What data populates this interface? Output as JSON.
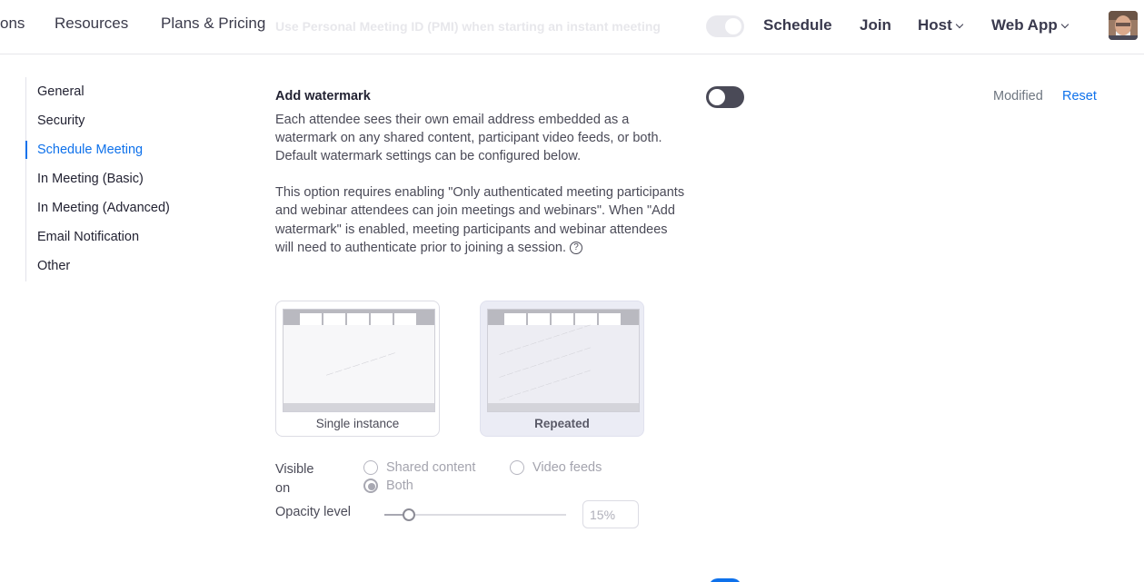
{
  "nav": {
    "left_items": [
      "ons",
      "Resources",
      "Plans & Pricing"
    ],
    "ghost_setting": "Use Personal Meeting ID (PMI) when starting an instant meeting",
    "right_items": {
      "schedule": "Schedule",
      "join": "Join",
      "host": "Host",
      "web_app": "Web App"
    }
  },
  "sidebar": {
    "items": [
      {
        "label": "General",
        "active": false
      },
      {
        "label": "Security",
        "active": false
      },
      {
        "label": "Schedule Meeting",
        "active": true
      },
      {
        "label": "In Meeting (Basic)",
        "active": false
      },
      {
        "label": "In Meeting (Advanced)",
        "active": false
      },
      {
        "label": "Email Notification",
        "active": false
      },
      {
        "label": "Other",
        "active": false
      }
    ]
  },
  "setting": {
    "title": "Add watermark",
    "enabled": false,
    "status": "Modified",
    "reset_label": "Reset",
    "desc1": "Each attendee sees their own email address embedded as a watermark on any shared content, participant video feeds, or both. Default watermark settings can be configured below.",
    "desc2": "This option requires enabling \"Only authenticated meeting participants and webinar attendees can join meetings and webinars\". When \"Add watermark\" is enabled, meeting participants and webinar attendees will need to authenticate prior to joining a session.",
    "help_icon": "question-circle-icon",
    "help_glyph": "?"
  },
  "modes": {
    "single": "Single instance",
    "repeated": "Repeated",
    "selected": "Repeated"
  },
  "visible_on": {
    "label_line1": "Visible",
    "label_line2": "on",
    "options": {
      "shared_content": "Shared content",
      "video_feeds": "Video feeds",
      "both": "Both"
    },
    "selected": "Both"
  },
  "opacity": {
    "label": "Opacity level",
    "value": "15%",
    "level_fraction": 0.1
  },
  "colors": {
    "accent": "#0e71eb",
    "toggle_off": "#4a4a57"
  }
}
